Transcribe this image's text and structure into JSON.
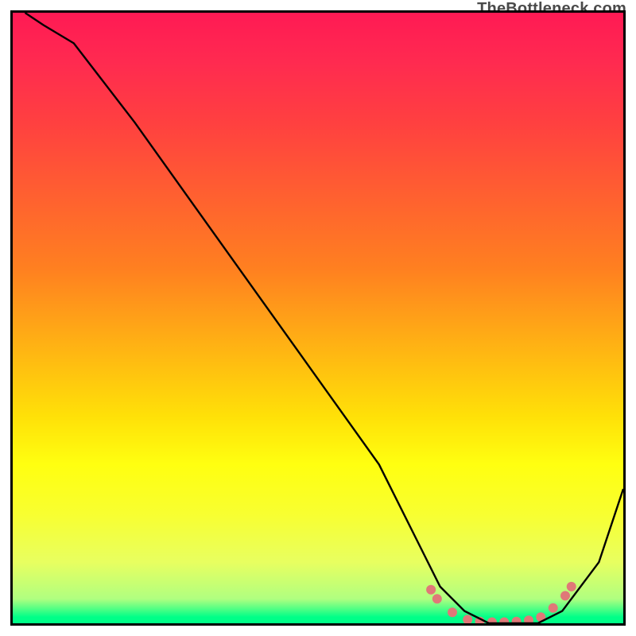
{
  "watermark": "TheBottleneck.com",
  "chart_data": {
    "type": "line",
    "title": "",
    "xlabel": "",
    "ylabel": "",
    "xlim": [
      0,
      100
    ],
    "ylim": [
      0,
      100
    ],
    "grid": false,
    "series": [
      {
        "name": "curve",
        "x": [
          2,
          5,
          10,
          20,
          30,
          40,
          50,
          60,
          66,
          70,
          74,
          78,
          82,
          86,
          90,
          96,
          100
        ],
        "y": [
          100,
          98,
          95,
          82,
          68,
          54,
          40,
          26,
          14,
          6,
          2,
          0,
          0,
          0,
          2,
          10,
          22
        ]
      }
    ],
    "markers": {
      "name": "dots",
      "x": [
        68.5,
        69.5,
        72.0,
        74.5,
        76.5,
        78.5,
        80.5,
        82.5,
        84.5,
        86.5,
        88.5,
        90.5,
        91.5
      ],
      "y": [
        5.5,
        4.0,
        1.8,
        0.6,
        0.3,
        0.2,
        0.2,
        0.3,
        0.5,
        1.0,
        2.5,
        4.5,
        6.0
      ]
    },
    "gradient_stops": [
      {
        "pct": 0,
        "color": "#ff1a54"
      },
      {
        "pct": 8,
        "color": "#ff2a50"
      },
      {
        "pct": 18,
        "color": "#ff4040"
      },
      {
        "pct": 30,
        "color": "#ff6030"
      },
      {
        "pct": 42,
        "color": "#ff8020"
      },
      {
        "pct": 50,
        "color": "#ffa018"
      },
      {
        "pct": 58,
        "color": "#ffc010"
      },
      {
        "pct": 66,
        "color": "#ffe008"
      },
      {
        "pct": 74,
        "color": "#ffff10"
      },
      {
        "pct": 82,
        "color": "#f8ff30"
      },
      {
        "pct": 90,
        "color": "#e8ff60"
      },
      {
        "pct": 96,
        "color": "#b0ff80"
      },
      {
        "pct": 99,
        "color": "#00ff88"
      },
      {
        "pct": 100,
        "color": "#00ff88"
      }
    ],
    "colors": {
      "curve": "#000000",
      "marker": "#e07878"
    }
  }
}
